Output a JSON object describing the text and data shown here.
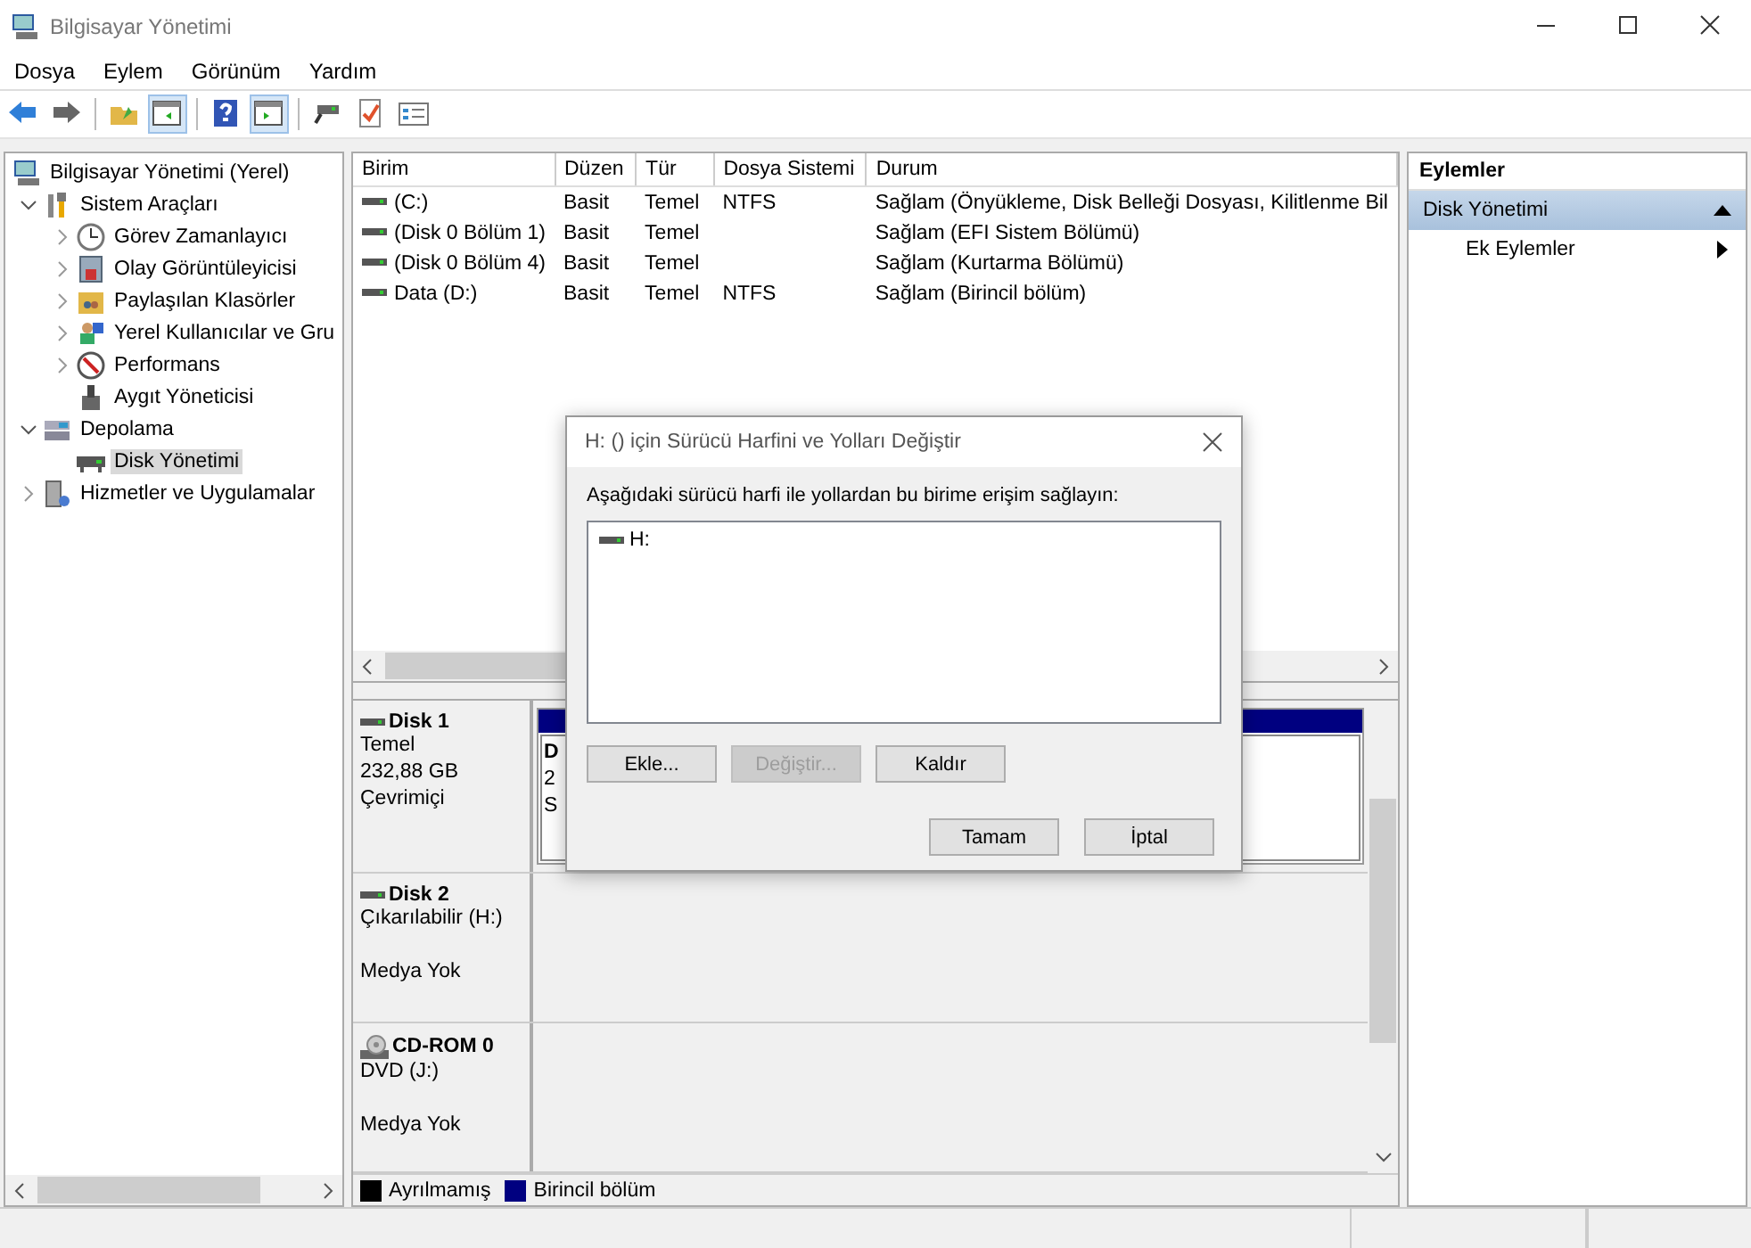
{
  "window": {
    "title": "Bilgisayar Yönetimi"
  },
  "menu": [
    "Dosya",
    "Eylem",
    "Görünüm",
    "Yardım"
  ],
  "toolbar": [
    [
      {
        "kind": "back",
        "on": false
      },
      {
        "kind": "forward",
        "on": false
      }
    ],
    [
      {
        "kind": "up",
        "on": false
      },
      {
        "kind": "tree",
        "on": true
      }
    ],
    [
      {
        "kind": "help",
        "on": false
      },
      {
        "kind": "pane",
        "on": true
      }
    ],
    [
      {
        "kind": "connect",
        "on": false
      },
      {
        "kind": "check",
        "on": false
      },
      {
        "kind": "list",
        "on": false
      }
    ]
  ],
  "tree": [
    {
      "label": "Bilgisayar Yönetimi (Yerel)",
      "kind": "computer",
      "selected": false,
      "children": [
        {
          "label": "Sistem Araçları",
          "kind": "tools",
          "expanded": true,
          "selected": false,
          "children": [
            {
              "label": "Görev Zamanlayıcı",
              "kind": "clock",
              "expanded": false,
              "selected": false
            },
            {
              "label": "Olay Görüntüleyicisi",
              "kind": "event",
              "expanded": false,
              "selected": false
            },
            {
              "label": "Paylaşılan Klasörler",
              "kind": "share",
              "expanded": false,
              "selected": false
            },
            {
              "label": "Yerel Kullanıcılar ve Gru",
              "kind": "users",
              "expanded": false,
              "selected": false
            },
            {
              "label": "Performans",
              "kind": "perf",
              "expanded": false,
              "selected": false
            },
            {
              "label": "Aygıt Yöneticisi",
              "kind": "device",
              "selected": false
            }
          ]
        },
        {
          "label": "Depolama",
          "kind": "storage",
          "expanded": true,
          "selected": false,
          "children": [
            {
              "label": "Disk Yönetimi",
              "kind": "disk",
              "selected": true
            }
          ]
        },
        {
          "label": "Hizmetler ve Uygulamalar",
          "kind": "services",
          "expanded": false,
          "selected": false
        }
      ]
    }
  ],
  "volumes": {
    "columns": [
      "Birim",
      "Düzen",
      "Tür",
      "Dosya Sistemi",
      "Durum"
    ],
    "rows": [
      [
        "(C:)",
        "Basit",
        "Temel",
        "NTFS",
        "Sağlam (Önyükleme, Disk Belleği Dosyası, Kilitlenme Bil"
      ],
      [
        "(Disk 0 Bölüm 1)",
        "Basit",
        "Temel",
        "",
        "Sağlam (EFI Sistem Bölümü)"
      ],
      [
        "(Disk 0 Bölüm 4)",
        "Basit",
        "Temel",
        "",
        "Sağlam (Kurtarma Bölümü)"
      ],
      [
        "Data (D:)",
        "Basit",
        "Temel",
        "NTFS",
        "Sağlam (Birincil bölüm)"
      ]
    ]
  },
  "disks": [
    {
      "name": "Disk 1",
      "kind": "hdd",
      "type": "Temel",
      "size": "232,88 GB",
      "status": "Çevrimiçi",
      "partition": {
        "color": "#000080",
        "lines": [
          "D",
          "2",
          "S"
        ]
      }
    },
    {
      "name": "Disk 2",
      "kind": "hdd",
      "type": "Çıkarılabilir (H:)",
      "status": "Medya Yok"
    },
    {
      "name": "CD-ROM 0",
      "kind": "cd",
      "type": "DVD (J:)",
      "status": "Medya Yok"
    }
  ],
  "legend": [
    {
      "label": "Ayrılmamış",
      "color": "#000000"
    },
    {
      "label": "Birincil bölüm",
      "color": "#000080"
    }
  ],
  "actions": {
    "title": "Eylemler",
    "section": "Disk Yönetimi",
    "items": [
      "Ek Eylemler"
    ]
  },
  "dialog": {
    "title": "H: () için Sürücü Harfini ve Yolları Değiştir",
    "prompt": "Aşağıdaki sürücü harfi ile yollardan bu birime erişim sağlayın:",
    "entries": [
      {
        "label": "H:",
        "selected": false
      }
    ],
    "buttons": [
      {
        "label": "Ekle...",
        "disabled": false
      },
      {
        "label": "Değiştir...",
        "disabled": true
      },
      {
        "label": "Kaldır",
        "disabled": false
      }
    ],
    "footer": [
      {
        "label": "Tamam",
        "disabled": false
      },
      {
        "label": "İptal",
        "disabled": false
      }
    ]
  }
}
